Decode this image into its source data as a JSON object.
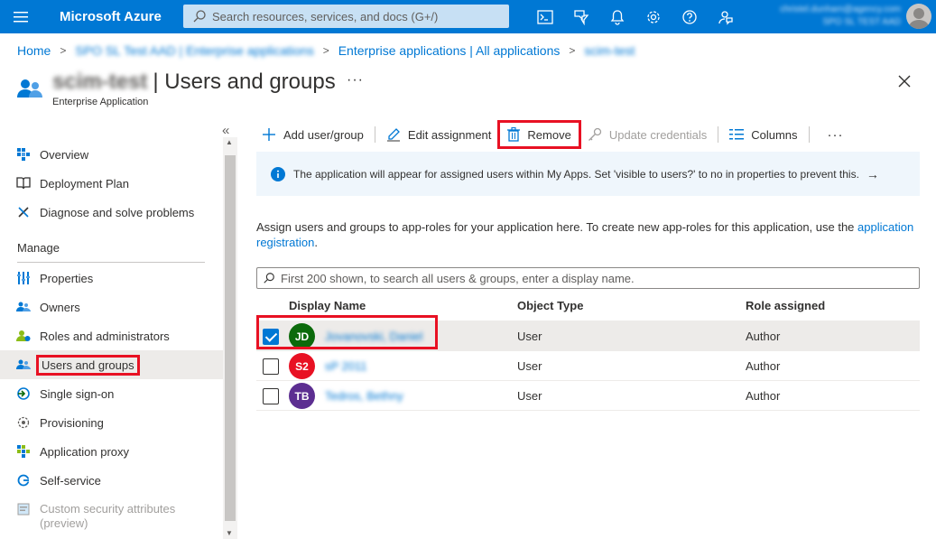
{
  "topbar": {
    "brand": "Microsoft Azure",
    "search_placeholder": "Search resources, services, and docs (G+/)",
    "account_line1": "christel.dunham@agency.com",
    "account_line2": "SPO SL TEST AAD",
    "icons": [
      "cloud-shell-icon",
      "directory-filter-icon",
      "notifications-icon",
      "settings-icon",
      "help-icon",
      "feedback-icon"
    ]
  },
  "breadcrumb": {
    "home": "Home",
    "item2": "SPO SL Test AAD | Enterprise applications",
    "item3": "Enterprise applications | All applications",
    "item4": "scim-test"
  },
  "header": {
    "resource_name": "scim-test",
    "title": "| Users and groups",
    "ellipsis": "···",
    "subtitle": "Enterprise Application"
  },
  "sidebar": {
    "collapse": "«",
    "items_top": [
      {
        "label": "Overview"
      },
      {
        "label": "Deployment Plan"
      },
      {
        "label": "Diagnose and solve problems"
      }
    ],
    "section_manage": "Manage",
    "items_manage": [
      {
        "label": "Properties"
      },
      {
        "label": "Owners"
      },
      {
        "label": "Roles and administrators"
      },
      {
        "label": "Users and groups"
      },
      {
        "label": "Single sign-on"
      },
      {
        "label": "Provisioning"
      },
      {
        "label": "Application proxy"
      },
      {
        "label": "Self-service"
      },
      {
        "label": "Custom security attributes (preview)"
      }
    ]
  },
  "toolbar": {
    "add": "Add user/group",
    "edit": "Edit assignment",
    "remove": "Remove",
    "update": "Update credentials",
    "columns": "Columns",
    "more": "···"
  },
  "info": {
    "text": "The application will appear for assigned users within My Apps. Set 'visible to users?' to no in properties to prevent this.",
    "arrow": "→"
  },
  "description": {
    "text": "Assign users and groups to app-roles for your application here. To create new app-roles for this application, use the ",
    "link": "application registration",
    "end": "."
  },
  "filter": {
    "placeholder": "First 200 shown, to search all users & groups, enter a display name."
  },
  "table": {
    "columns": [
      "Display Name",
      "Object Type",
      "Role assigned"
    ],
    "rows": [
      {
        "initials": "JD",
        "name": "Jovanovski, Daniel",
        "type": "User",
        "role": "Author",
        "color": "#0b6a0b",
        "checked": true
      },
      {
        "initials": "S2",
        "name": "sP 2011",
        "type": "User",
        "role": "Author",
        "color": "#e81123",
        "checked": false
      },
      {
        "initials": "TB",
        "name": "Tedros, Bethny",
        "type": "User",
        "role": "Author",
        "color": "#5c2e91",
        "checked": false
      }
    ]
  },
  "colors": {
    "accent": "#0078d4",
    "highlight": "#e81123"
  }
}
